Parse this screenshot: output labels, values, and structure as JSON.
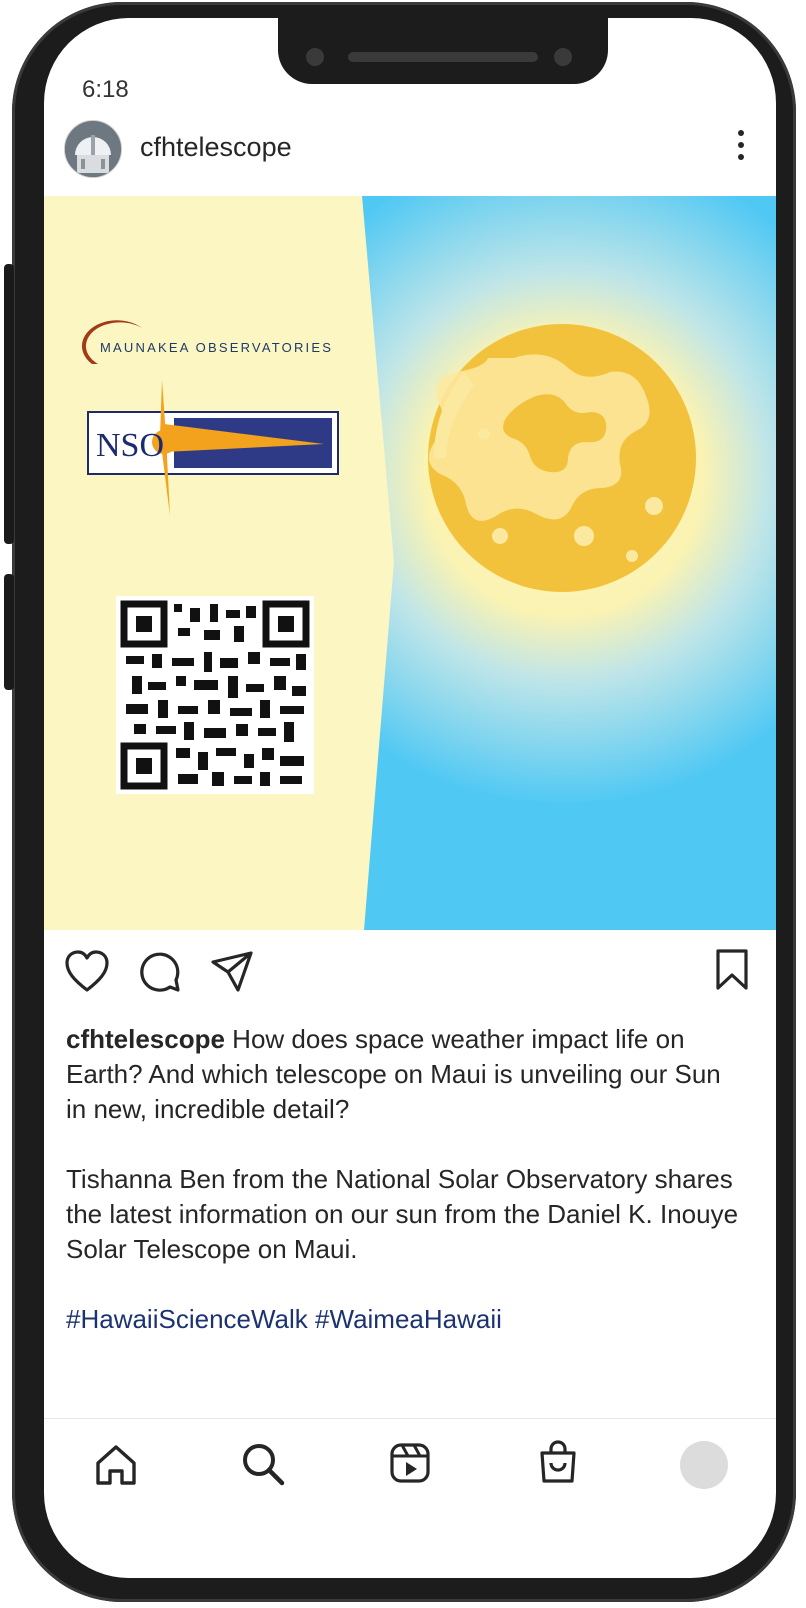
{
  "status_bar": {
    "time": "6:18"
  },
  "post": {
    "username": "cfhtelescope",
    "image": {
      "logo_maunakea": "MAUNAKEA OBSERVATORIES",
      "logo_nso": "NSO",
      "left_panel_color": "#fcf6c2",
      "sky_color": "#4fc8f4",
      "sun_color": "#f3c23c"
    },
    "caption": {
      "username": "cfhtelescope",
      "text_1": " How does space weather impact life on Earth? And which telescope on Maui is unveiling our Sun in new, incredible detail?",
      "text_2": "Tishanna Ben from the National Solar Observatory shares the latest information on our sun from the Daniel K. Inouye Solar Telescope on Maui.",
      "hashtags": [
        "#HawaiiScienceWalk",
        "#WaimeaHawaii"
      ]
    },
    "actions": [
      "heart-icon",
      "comment-icon",
      "share-icon",
      "bookmark-icon"
    ]
  },
  "tabbar": {
    "items": [
      "home-icon",
      "search-icon",
      "reels-icon",
      "shop-icon",
      "profile-avatar"
    ]
  }
}
